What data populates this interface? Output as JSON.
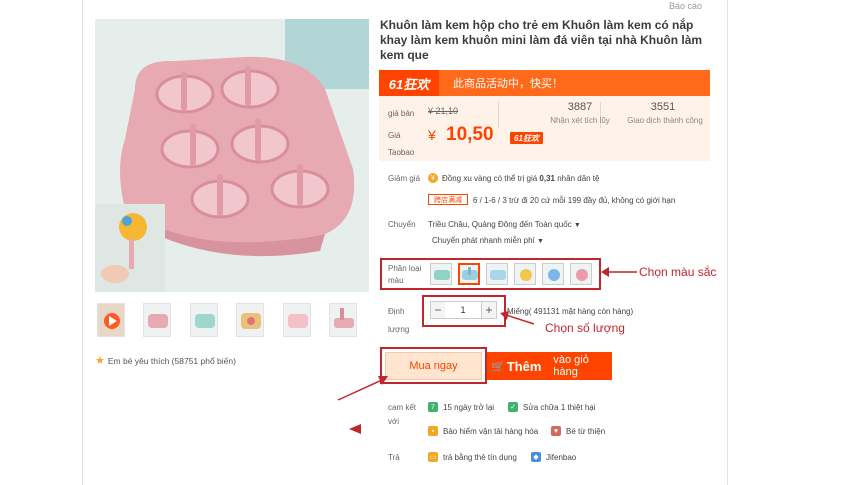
{
  "report_link": "Báo cáo",
  "product": {
    "title": "Khuôn làm kem hộp cho trẻ em Khuôn làm kem có nắp khay làm kem khuôn mini làm đá viên tại nhà Khuôn làm kem que"
  },
  "favorites_text": "Em bé yêu thích (58751 phổ biến)",
  "promo": {
    "tag": "61狂欢",
    "message": "此商品活动中，快买！"
  },
  "price": {
    "label_price": "giá bán",
    "old_price": "¥ 21,10",
    "label_taobao_1": "Giá",
    "label_taobao_2": "Taobao",
    "currency": "¥",
    "new_price": "10,50",
    "badge": "61狂欢"
  },
  "stats": {
    "reviews_value": "3887",
    "reviews_label": "Nhận xét tích lũy",
    "transactions_value": "3551",
    "transactions_label": "Giao dịch thành công"
  },
  "discount": {
    "label": "Giảm giá",
    "coin_text_1": "Đồng xu vàng có thể trị giá",
    "coin_value": "0,31",
    "coin_text_2": "nhân dân tệ",
    "tag": "跨店满减",
    "rule": "6 / 1-6 / 3 trừ đi 20 cứ mỗi 199 đầy đủ, không có giới hạn"
  },
  "shipping": {
    "label": "Chuyển",
    "route": "Triều Châu, Quảng Đông đến Toàn quốc",
    "method": "Chuyển phát nhanh miễn phí"
  },
  "variant": {
    "label_1": "Phân loại",
    "label_2": "màu",
    "annotation": "Chọn màu sắc"
  },
  "quantity": {
    "label_1": "Định",
    "label_2": "lượng",
    "minus": "−",
    "value": "1",
    "plus": "+",
    "stock_text": "Miếng( 491131 mặt hàng còn hàng)",
    "annotation": "Chọn số lượng"
  },
  "actions": {
    "buy_now": "Mua ngay",
    "add_cart_big": "Thêm",
    "add_cart_rest": "vào giỏ hàng"
  },
  "commit": {
    "label_1": "cam kết",
    "label_2": "với",
    "item_1": "15 ngày trở lại",
    "item_2": "Sửa chữa 1 thiệt hại",
    "item_3": "Bảo hiểm vận tải hàng hóa",
    "item_4": "Bé từ thiện"
  },
  "pay": {
    "label": "Trả",
    "item_1": "trả bằng thẻ tín dụng",
    "item_2": "Jifenbao"
  },
  "colors": {
    "accent": "#ff4400",
    "annotation_red": "#c0262d",
    "mold_pink": "#e7a9b2"
  }
}
